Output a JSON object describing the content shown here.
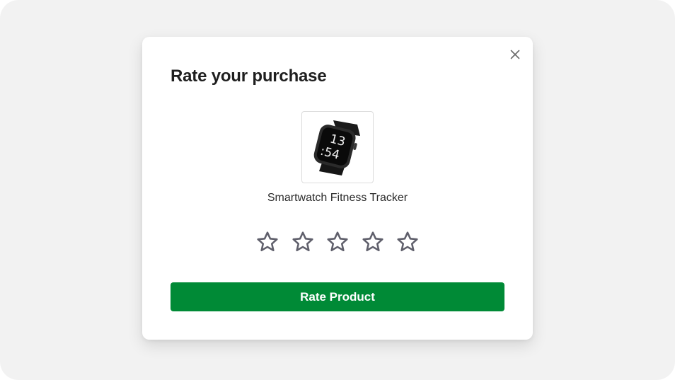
{
  "modal": {
    "title": "Rate your purchase",
    "close_icon": "close-icon"
  },
  "product": {
    "name": "Smartwatch Fitness Tracker",
    "image_icon": "smartwatch-image",
    "watch_face_hour": "13",
    "watch_face_minute": ":54"
  },
  "rating": {
    "max_stars": 5,
    "selected": 0,
    "star_icon": "star-outline-icon",
    "star_color": "#5f5f6b"
  },
  "button": {
    "label": "Rate Product",
    "color": "#008a36"
  },
  "colors": {
    "backdrop": "#f2f2f2",
    "modal": "#ffffff",
    "title_text": "#1f1f1f"
  }
}
